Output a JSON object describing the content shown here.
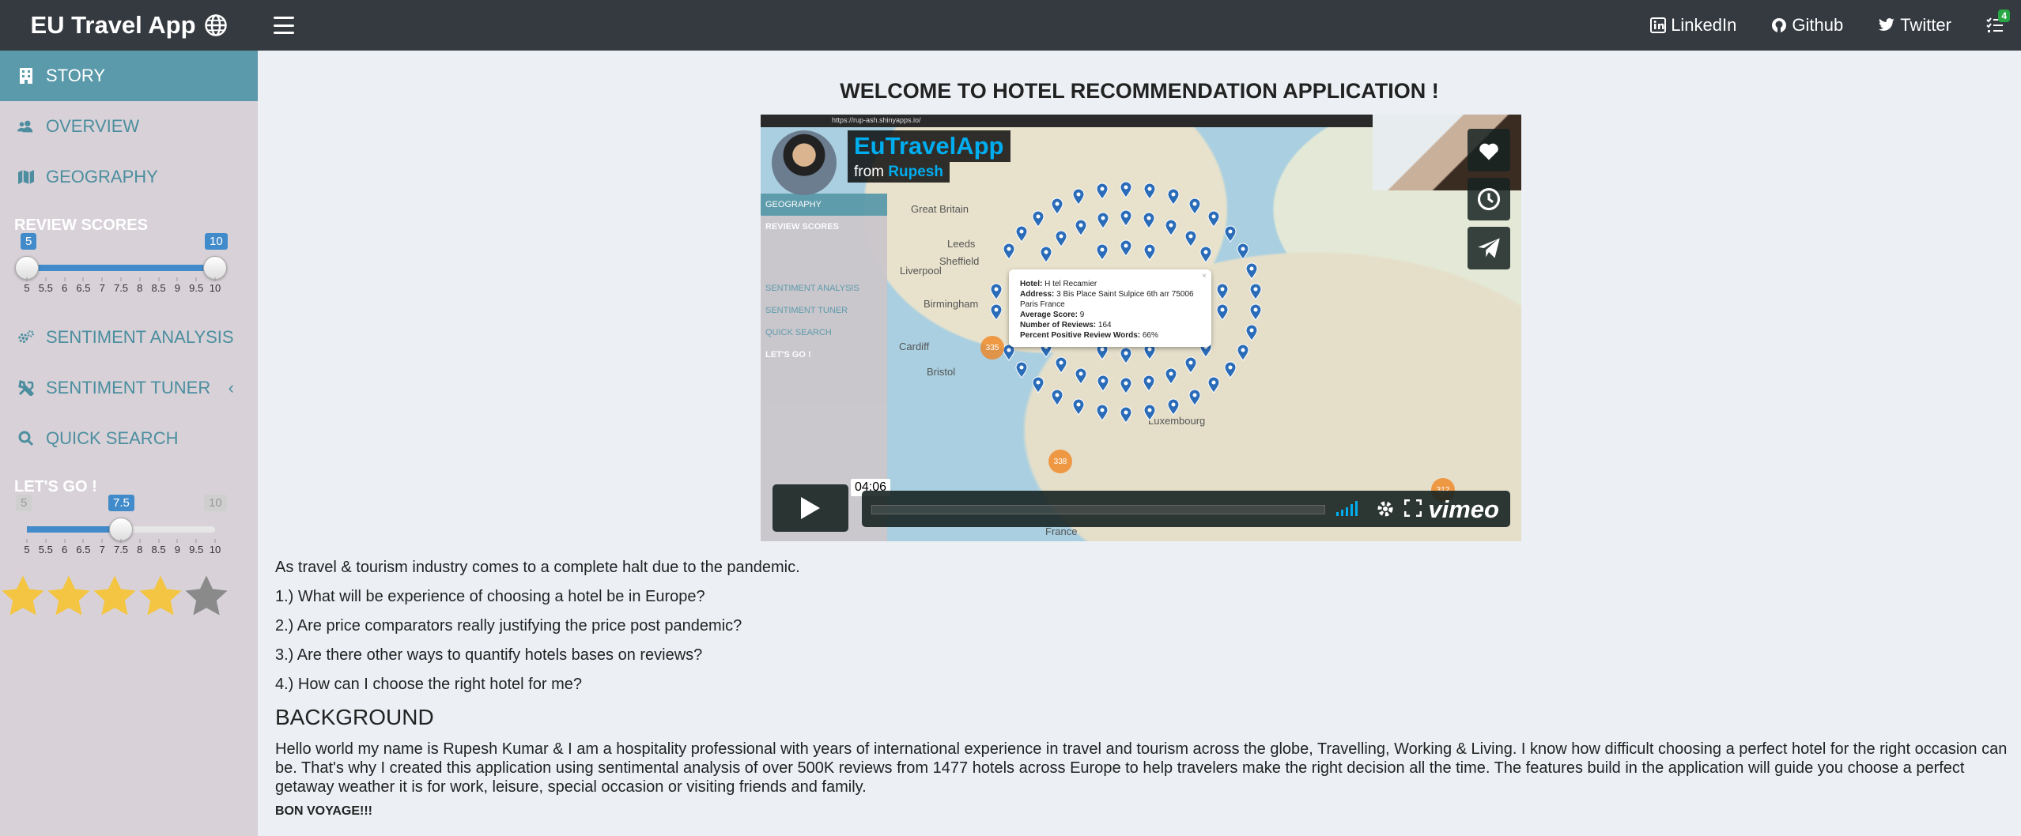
{
  "header": {
    "brand": "EU Travel App",
    "links": [
      {
        "label": "LinkedIn",
        "icon": "linkedin-icon"
      },
      {
        "label": "Github",
        "icon": "github-icon"
      },
      {
        "label": "Twitter",
        "icon": "twitter-icon"
      }
    ],
    "tasks_badge": "4"
  },
  "sidebar": {
    "items": [
      {
        "label": "STORY",
        "icon": "building-icon",
        "active": true
      },
      {
        "label": "OVERVIEW",
        "icon": "users-icon"
      },
      {
        "label": "GEOGRAPHY",
        "icon": "map-icon"
      }
    ],
    "review_scores": {
      "label": "REVIEW SCORES",
      "min": 5,
      "max": 10,
      "from": "5",
      "to": "10",
      "ticks": [
        "5",
        "5.5",
        "6",
        "6.5",
        "7",
        "7.5",
        "8",
        "8.5",
        "9",
        "9.5",
        "10"
      ]
    },
    "items2": [
      {
        "label": "SENTIMENT ANALYSIS",
        "icon": "cogs-icon"
      },
      {
        "label": "SENTIMENT TUNER",
        "icon": "tools-icon",
        "chevron": "‹"
      },
      {
        "label": "QUICK SEARCH",
        "icon": "search-icon"
      }
    ],
    "lets_go": {
      "label": "LET'S GO !",
      "min": "5",
      "max": "10",
      "value": "7.5",
      "ticks": [
        "5",
        "5.5",
        "6",
        "6.5",
        "7",
        "7.5",
        "8",
        "8.5",
        "9",
        "9.5",
        "10"
      ]
    },
    "rating": {
      "filled": 4,
      "total": 5
    }
  },
  "main": {
    "title": "WELCOME TO HOTEL RECOMMENDATION APPLICATION !",
    "video": {
      "title": "EuTravelApp",
      "from_prefix": "from",
      "author": "Rupesh",
      "timecode": "04:06",
      "brand": "vimeo",
      "browser_url": "https://rup-ash.shinyapps.io/",
      "inner_menu": [
        "GEOGRAPHY",
        "REVIEW SCORES",
        "SENTIMENT ANALYSIS",
        "SENTIMENT TUNER",
        "QUICK SEARCH",
        "LET'S GO !"
      ],
      "popup": {
        "hotel_label": "Hotel:",
        "hotel": "H tel Recamier",
        "address_label": "Address:",
        "address": "3 Bis Place Saint Sulpice 6th arr 75006 Paris France",
        "score_label": "Average Score:",
        "score": "9",
        "reviews_label": "Number of Reviews:",
        "reviews": "164",
        "positive_label": "Percent Positive Review Words:",
        "positive": "66%"
      },
      "clusters": [
        "335",
        "338",
        "312"
      ],
      "cities": [
        "Great Britain",
        "Leeds",
        "Sheffield",
        "Liverpool",
        "Birmingham",
        "Cardiff",
        "Bristol",
        "France",
        "Luxembourg"
      ]
    },
    "intro": "As travel & tourism industry comes to a complete halt due to the pandemic.",
    "questions": [
      "1.) What will be experience of choosing a hotel be in Europe?",
      "2.) Are price comparators really justifying the price post pandemic?",
      "3.) Are there other ways to quantify hotels bases on reviews?",
      "4.) How can I choose the right hotel for me?"
    ],
    "background_heading": "BACKGROUND",
    "background_text": "Hello world my name is Rupesh Kumar & I am a hospitality professional with years of international experience in travel and tourism across the globe, Travelling, Working & Living. I know how difficult choosing a perfect hotel for the right occasion can be. That's why I created this application using sentimental analysis of over 500K reviews from 1477 hotels across Europe to help travelers make the right decision all the time. The features build in the application will guide you choose a perfect getaway weather it is for work, leisure, special occasion or visiting friends and family.",
    "signoff": "BON VOYAGE!!!"
  },
  "colors": {
    "header_bg": "#343a40",
    "sidebar_bg": "#d8d2d8",
    "active_item": "#5a9aaa",
    "menu_text": "#4c8e9f",
    "slider_fill": "#428bca",
    "star_gold": "#f4c542",
    "star_grey": "#8a8a8a",
    "vimeo_blue": "#00adef"
  }
}
